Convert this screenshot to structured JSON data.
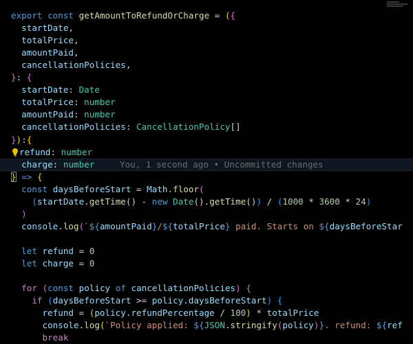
{
  "editor": {
    "blame_annotation": "You, 1 second ago • Uncommitted changes",
    "lines": [
      {
        "t": [
          "kw:export",
          "punc: ",
          "kw:const",
          "punc: ",
          "fn:getAmountToRefundOrCharge",
          "punc: = ",
          "br1:(",
          "br2:{"
        ]
      },
      {
        "t": [
          "punc:  ",
          "var:startDate",
          "punc:,"
        ]
      },
      {
        "t": [
          "punc:  ",
          "var:totalPrice",
          "punc:,"
        ]
      },
      {
        "t": [
          "punc:  ",
          "var:amountPaid",
          "punc:,"
        ]
      },
      {
        "t": [
          "punc:  ",
          "var:cancellationPolicies",
          "punc:,"
        ]
      },
      {
        "t": [
          "br2:}",
          "punc:: ",
          "br2:{"
        ]
      },
      {
        "t": [
          "punc:  ",
          "var:startDate",
          "punc:: ",
          "ty:Date"
        ]
      },
      {
        "t": [
          "punc:  ",
          "var:totalPrice",
          "punc:: ",
          "ty:number"
        ]
      },
      {
        "t": [
          "punc:  ",
          "var:amountPaid",
          "punc:: ",
          "ty:number"
        ]
      },
      {
        "t": [
          "punc:  ",
          "var:cancellationPolicies",
          "punc:: ",
          "ty:CancellationPolicy",
          "punc:[]"
        ]
      },
      {
        "t": [
          "br2:}",
          "br1:)",
          "punc::",
          "br1:{"
        ]
      },
      {
        "t": [
          "punc:  ",
          "var:refund",
          "punc:: ",
          "ty:number"
        ]
      },
      {
        "t": [
          "punc:  ",
          "var:charge",
          "punc:: ",
          "ty:number"
        ],
        "current": true
      },
      {
        "t": [
          "br1:}",
          "punc: ",
          "kw:=>",
          "punc: ",
          "br1:{"
        ]
      },
      {
        "t": [
          "punc:  ",
          "kw:const",
          "punc: ",
          "var:daysBeforeStart",
          "punc: = ",
          "var:Math",
          "punc:.",
          "fn:floor",
          "br2:("
        ]
      },
      {
        "t": [
          "punc:    ",
          "br3:(",
          "var:startDate",
          "punc:.",
          "fn:getTime",
          "punc:() - ",
          "kw:new",
          "punc: ",
          "ty:Date",
          "punc:().",
          "fn:getTime",
          "punc:()",
          "br3:)",
          "punc: / ",
          "br3:(",
          "num:1000",
          "punc: * ",
          "num:3600",
          "punc: * ",
          "num:24",
          "br3:)"
        ]
      },
      {
        "t": [
          "punc:  ",
          "br2:)"
        ]
      },
      {
        "t": [
          "punc:  ",
          "var:console",
          "punc:.",
          "fn:log",
          "br2:(",
          "str:`",
          "kw:${",
          "var:amountPaid",
          "kw:}",
          "str:/",
          "kw:${",
          "var:totalPrice",
          "kw:}",
          "str: paid. Starts on ",
          "kw:${",
          "var:daysBeforeStar"
        ]
      },
      {
        "t": []
      },
      {
        "t": [
          "punc:  ",
          "kw:let",
          "punc: ",
          "var:refund",
          "punc: = ",
          "num:0"
        ]
      },
      {
        "t": [
          "punc:  ",
          "kw:let",
          "punc: ",
          "var:charge",
          "punc: = ",
          "num:0"
        ]
      },
      {
        "t": []
      },
      {
        "t": [
          "punc:  ",
          "kw2:for",
          "punc: ",
          "br2:(",
          "kw:const",
          "punc: ",
          "var:policy",
          "punc: ",
          "kw:of",
          "punc: ",
          "var:cancellationPolicies",
          "br2:)",
          "punc: ",
          "br2:{"
        ]
      },
      {
        "t": [
          "punc:    ",
          "kw2:if",
          "punc: ",
          "br3:(",
          "var:daysBeforeStart",
          "punc: >= ",
          "var:policy",
          "punc:.",
          "var:daysBeforeStart",
          "br3:)",
          "punc: ",
          "br3:{"
        ]
      },
      {
        "t": [
          "punc:      ",
          "var:refund",
          "punc: = ",
          "br1:(",
          "var:policy",
          "punc:.",
          "var:refundPercentage",
          "punc: / ",
          "num:100",
          "br1:)",
          "punc: * ",
          "var:totalPrice"
        ]
      },
      {
        "t": [
          "punc:      ",
          "var:console",
          "punc:.",
          "fn:log",
          "br1:(",
          "str:`Policy applied: ",
          "kw:${",
          "ty:JSON",
          "punc:.",
          "fn:stringify",
          "br2:(",
          "var:policy",
          "br2:)",
          "kw:}",
          "str:. refund: ",
          "kw:${",
          "var:ref"
        ]
      },
      {
        "t": [
          "punc:      ",
          "kw2:break"
        ]
      }
    ]
  }
}
